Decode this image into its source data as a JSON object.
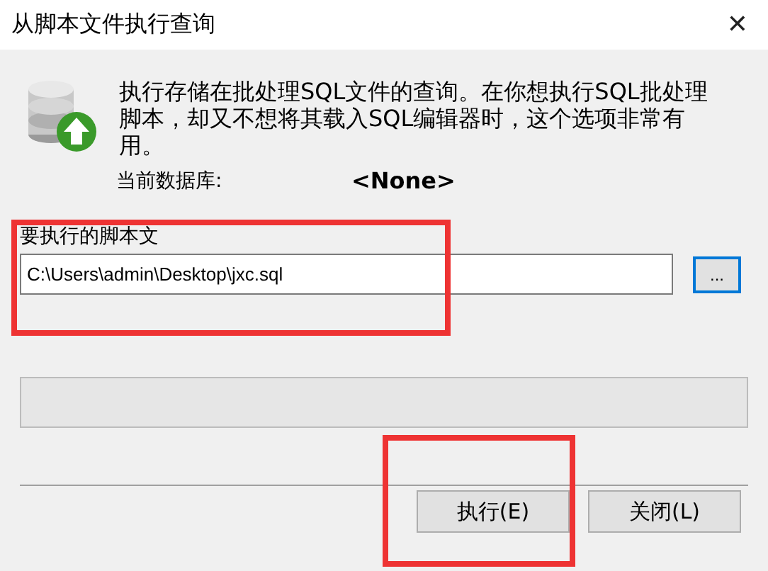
{
  "window": {
    "title": "从脚本文件执行查询",
    "close": "✕"
  },
  "description": "执行存储在批处理SQL文件的查询。在你想执行SQL批处理脚本，却又不想将其载入SQL编辑器时，这个选项非常有用。",
  "database": {
    "label": "当前数据库:",
    "value": "<None>"
  },
  "script": {
    "label": "要执行的脚本文",
    "value": "C:\\Users\\admin\\Desktop\\jxc.sql",
    "browse": "..."
  },
  "buttons": [
    {
      "label": "执行(E)"
    },
    {
      "label": "关闭(L)"
    }
  ],
  "annotations": [
    {
      "color": "#ee3333"
    },
    {
      "color": "#ee3333"
    }
  ]
}
